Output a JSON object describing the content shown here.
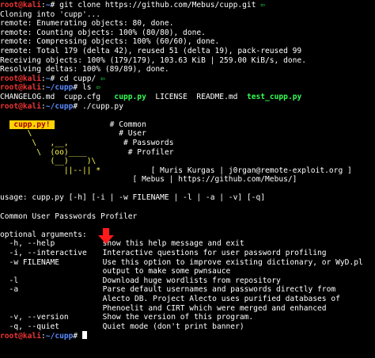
{
  "prompt": {
    "user": "root@kali",
    "sep": ":",
    "path": "~",
    "hash": "#"
  },
  "prompt_cupp": {
    "path": "~/cupp"
  },
  "cmd1": "git clone https://github.com/Mebus/cupp.git",
  "git_output": [
    "Cloning into 'cupp'...",
    "remote: Enumerating objects: 80, done.",
    "remote: Counting objects: 100% (80/80), done.",
    "remote: Compressing objects: 100% (60/60), done.",
    "remote: Total 179 (delta 42), reused 51 (delta 19), pack-reused 99",
    "Receiving objects: 100% (179/179), 103.63 KiB | 259.00 KiB/s, done.",
    "Resolving deltas: 100% (89/89), done."
  ],
  "cmd2": "cd cupp/",
  "cmd3": "ls",
  "ls_files": {
    "changelog": "CHANGELOG.md",
    "cfg": "cupp.cfg",
    "py": "cupp.py",
    "license": "LICENSE",
    "readme": "README.md",
    "test": "test_cupp.py"
  },
  "cmd4": "./cupp.py",
  "banner": {
    "tag": " cupp.py! ",
    "art": [
      "      \\",
      "       \\   ,__,",
      "        \\  (oo)____",
      "           (__)    )\\",
      "              ||--|| *"
    ],
    "comments": [
      "# Common",
      "# User",
      "# Passwords",
      "# Profiler"
    ],
    "author": "[ Muris Kurgas | j0rgan@remote-exploit.org ]",
    "mebus": "[ Mebus | https://github.com/Mebus/]"
  },
  "usage": "usage: cupp.py [-h] [-i | -w FILENAME | -l | -a | -v] [-q]",
  "title": "Common User Passwords Profiler",
  "optional_header": "optional arguments:",
  "args": [
    {
      "flag": "  -h, --help",
      "desc": [
        "show this help message and exit"
      ]
    },
    {
      "flag": "  -i, --interactive",
      "desc": [
        "Interactive questions for user password profiling"
      ]
    },
    {
      "flag": "  -w FILENAME",
      "desc": [
        "Use this option to improve existing dictionary, or WyD.pl",
        "output to make some pwnsauce"
      ]
    },
    {
      "flag": "  -l",
      "desc": [
        "Download huge wordlists from repository"
      ]
    },
    {
      "flag": "  -a",
      "desc": [
        "Parse default usernames and passwords directly from",
        "Alecto DB. Project Alecto uses purified databases of",
        "Phenoelit and CIRT which were merged and enhanced"
      ]
    },
    {
      "flag": "  -v, --version",
      "desc": [
        "Show the version of this program."
      ]
    },
    {
      "flag": "  -q, --quiet",
      "desc": [
        "Quiet mode (don't print banner)"
      ]
    }
  ],
  "colors": {
    "prompt_red": "#ee3333",
    "path_blue": "#5c8cff",
    "banner_yellow": "#ffd400",
    "exec_green": "#33ff55",
    "arrow_green": "#22cc44",
    "arrow_red": "#ff1a1a"
  },
  "icons": {
    "annotation_arrow": "green-arrow-icon",
    "pointer_arrow": "red-down-arrow-icon"
  }
}
